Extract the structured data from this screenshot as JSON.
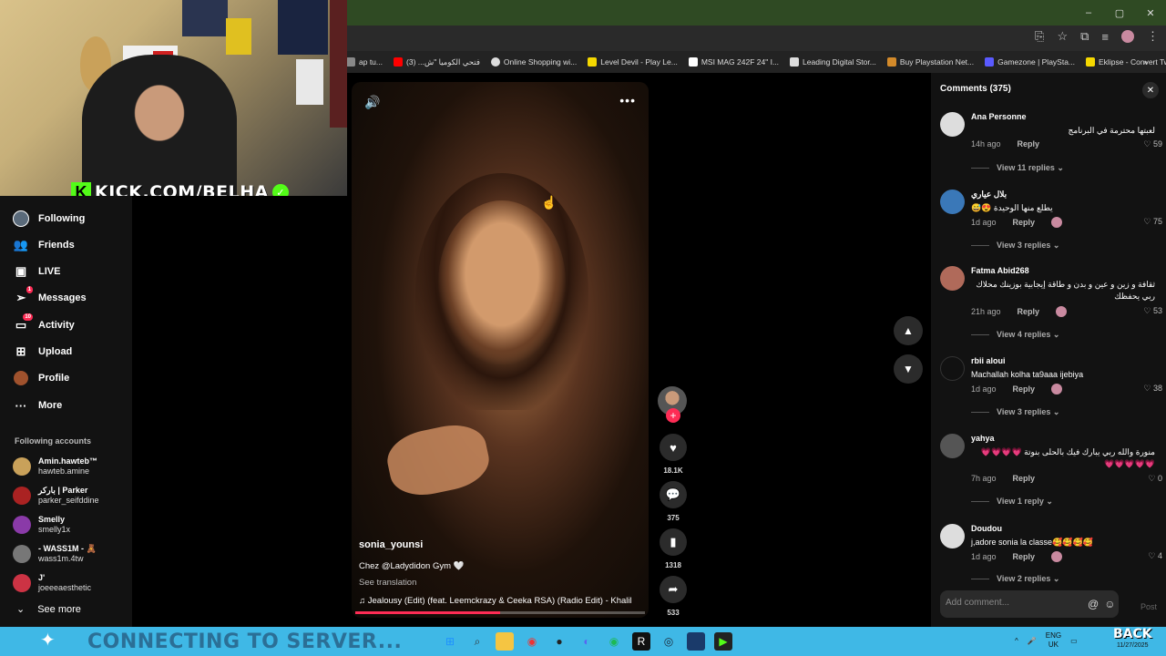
{
  "browser": {
    "window_controls": [
      "–",
      "▢",
      "✕"
    ],
    "bookmarks": [
      {
        "label": "ap tu...",
        "color": "#888888"
      },
      {
        "label": "فتحي الكوميا \"ش... (3)",
        "color": "#ff0000"
      },
      {
        "label": "Online Shopping wi...",
        "color": "#dddddd"
      },
      {
        "label": "Level Devil - Play Le...",
        "color": "#f5d800"
      },
      {
        "label": "MSI MAG 242F 24\" I...",
        "color": "#ffffff"
      },
      {
        "label": "Leading Digital Stor...",
        "color": "#dddddd"
      },
      {
        "label": "Buy Playstation Net...",
        "color": "#d38a2a"
      },
      {
        "label": "Gamezone | PlaySta...",
        "color": "#5a5aff"
      },
      {
        "label": "Eklipse - Convert Tw...",
        "color": "#f5d800"
      }
    ]
  },
  "sidebar": {
    "nav": [
      {
        "label": "Following",
        "icon": "following-avatar-icon",
        "badge": ""
      },
      {
        "label": "Friends",
        "icon": "friends-icon",
        "badge": ""
      },
      {
        "label": "LIVE",
        "icon": "live-icon",
        "badge": ""
      },
      {
        "label": "Messages",
        "icon": "messages-icon",
        "badge": "1"
      },
      {
        "label": "Activity",
        "icon": "activity-icon",
        "badge": "10"
      },
      {
        "label": "Upload",
        "icon": "upload-icon",
        "badge": ""
      },
      {
        "label": "Profile",
        "icon": "profile-icon",
        "badge": ""
      },
      {
        "label": "More",
        "icon": "more-icon",
        "badge": ""
      }
    ],
    "following_title": "Following accounts",
    "accounts": [
      {
        "name": "Amin.hawteb™",
        "handle": "hawteb.amine",
        "color": "#c9a15a"
      },
      {
        "name": "باركر | Parker",
        "handle": "parker_seifddine",
        "color": "#aa2222"
      },
      {
        "name": "Smelly",
        "handle": "smelly1x",
        "color": "#8a3aa8"
      },
      {
        "name": "- WASS1M - 🧸",
        "handle": "wass1m.4tw",
        "color": "#777777"
      },
      {
        "name": "J'",
        "handle": "joeeeaesthetic",
        "color": "#cc3344"
      }
    ],
    "see_more": "See more"
  },
  "webcam": {
    "kick_letter": "K",
    "kick_text": "KICK.COM/BELHA",
    "check": "✓"
  },
  "video": {
    "author": "sonia_younsi",
    "description": "Chez @Ladydidon Gym 🤍",
    "see_translation": "See translation",
    "music": "♫  Jealousy (Edit) (feat. Leemckrazy & Ceeka RSA) (Radio Edit) - Khalil",
    "progress": 0.5,
    "volume_glyph": "🔊",
    "more_glyph": "•••"
  },
  "actions": {
    "follow_glyph": "+",
    "like_count": "18.1K",
    "comment_count": "375",
    "save_count": "1318",
    "share_count": "533"
  },
  "comments": {
    "title": "Comments (375)",
    "items": [
      {
        "user": "Ana Personne",
        "text": "لعبتها محترمة في البرنامج",
        "rtl": true,
        "time": "14h ago",
        "reply": "Reply",
        "likes": "59",
        "replies": "View 11 replies ⌄",
        "avatar": "#dddddd",
        "heart_avatar": false
      },
      {
        "user": "بلال عياري",
        "text": "يطلع منها الوحيدة 😍😅",
        "rtl": true,
        "time": "1d ago",
        "reply": "Reply",
        "likes": "75",
        "replies": "View 3 replies ⌄",
        "avatar": "#3a78b8",
        "heart_avatar": true
      },
      {
        "user": "Fatma Abid268",
        "text": "ثقافة و زين و عين و بدن و طاقة إيجابية بوزينك محلاك ربي يحفظك",
        "rtl": true,
        "time": "21h ago",
        "reply": "Reply",
        "likes": "53",
        "replies": "View 4 replies ⌄",
        "avatar": "#b06a5a",
        "heart_avatar": true
      },
      {
        "user": "rbii aloui",
        "text": "Machallah kolha ta9aaa ijebiya",
        "rtl": false,
        "time": "1d ago",
        "reply": "Reply",
        "likes": "38",
        "replies": "View 3 replies ⌄",
        "avatar": "#111111",
        "heart_avatar": true
      },
      {
        "user": "yahya",
        "text": "منورة والله ربي يبارك فيك بالحلى بنوتة 💗💗💗💗💗💗💗💗💗",
        "rtl": true,
        "time": "7h ago",
        "reply": "Reply",
        "likes": "0",
        "replies": "View 1 reply ⌄",
        "avatar": "#555555",
        "heart_avatar": false
      },
      {
        "user": "Doudou",
        "text": "j,adore sonia la classe🥰🥰🥰🥰",
        "rtl": false,
        "time": "1d ago",
        "reply": "Reply",
        "likes": "4",
        "replies": "View 2 replies ⌄",
        "avatar": "#dddddd",
        "heart_avatar": true
      }
    ],
    "add_placeholder": "Add comment...",
    "post_label": "Post"
  },
  "taskbar": {
    "overlay_text": "CONNECTING TO SERVER...",
    "lang": "ENG",
    "region": "UK",
    "back_text": "BACK",
    "date": "11/27/2025"
  }
}
